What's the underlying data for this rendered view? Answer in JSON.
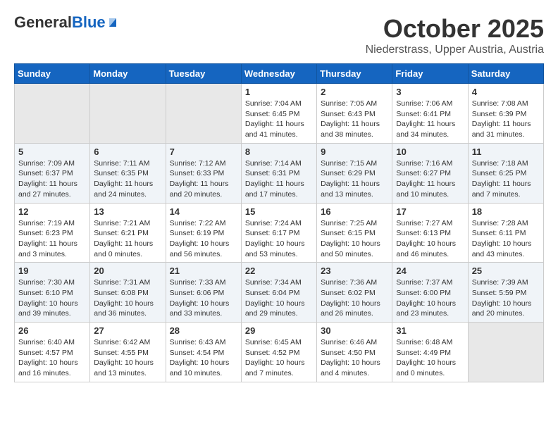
{
  "header": {
    "logo_general": "General",
    "logo_blue": "Blue",
    "month_title": "October 2025",
    "subtitle": "Niederstrass, Upper Austria, Austria"
  },
  "weekdays": [
    "Sunday",
    "Monday",
    "Tuesday",
    "Wednesday",
    "Thursday",
    "Friday",
    "Saturday"
  ],
  "weeks": [
    [
      {
        "day": "",
        "info": ""
      },
      {
        "day": "",
        "info": ""
      },
      {
        "day": "",
        "info": ""
      },
      {
        "day": "1",
        "info": "Sunrise: 7:04 AM\nSunset: 6:45 PM\nDaylight: 11 hours\nand 41 minutes."
      },
      {
        "day": "2",
        "info": "Sunrise: 7:05 AM\nSunset: 6:43 PM\nDaylight: 11 hours\nand 38 minutes."
      },
      {
        "day": "3",
        "info": "Sunrise: 7:06 AM\nSunset: 6:41 PM\nDaylight: 11 hours\nand 34 minutes."
      },
      {
        "day": "4",
        "info": "Sunrise: 7:08 AM\nSunset: 6:39 PM\nDaylight: 11 hours\nand 31 minutes."
      }
    ],
    [
      {
        "day": "5",
        "info": "Sunrise: 7:09 AM\nSunset: 6:37 PM\nDaylight: 11 hours\nand 27 minutes."
      },
      {
        "day": "6",
        "info": "Sunrise: 7:11 AM\nSunset: 6:35 PM\nDaylight: 11 hours\nand 24 minutes."
      },
      {
        "day": "7",
        "info": "Sunrise: 7:12 AM\nSunset: 6:33 PM\nDaylight: 11 hours\nand 20 minutes."
      },
      {
        "day": "8",
        "info": "Sunrise: 7:14 AM\nSunset: 6:31 PM\nDaylight: 11 hours\nand 17 minutes."
      },
      {
        "day": "9",
        "info": "Sunrise: 7:15 AM\nSunset: 6:29 PM\nDaylight: 11 hours\nand 13 minutes."
      },
      {
        "day": "10",
        "info": "Sunrise: 7:16 AM\nSunset: 6:27 PM\nDaylight: 11 hours\nand 10 minutes."
      },
      {
        "day": "11",
        "info": "Sunrise: 7:18 AM\nSunset: 6:25 PM\nDaylight: 11 hours\nand 7 minutes."
      }
    ],
    [
      {
        "day": "12",
        "info": "Sunrise: 7:19 AM\nSunset: 6:23 PM\nDaylight: 11 hours\nand 3 minutes."
      },
      {
        "day": "13",
        "info": "Sunrise: 7:21 AM\nSunset: 6:21 PM\nDaylight: 11 hours\nand 0 minutes."
      },
      {
        "day": "14",
        "info": "Sunrise: 7:22 AM\nSunset: 6:19 PM\nDaylight: 10 hours\nand 56 minutes."
      },
      {
        "day": "15",
        "info": "Sunrise: 7:24 AM\nSunset: 6:17 PM\nDaylight: 10 hours\nand 53 minutes."
      },
      {
        "day": "16",
        "info": "Sunrise: 7:25 AM\nSunset: 6:15 PM\nDaylight: 10 hours\nand 50 minutes."
      },
      {
        "day": "17",
        "info": "Sunrise: 7:27 AM\nSunset: 6:13 PM\nDaylight: 10 hours\nand 46 minutes."
      },
      {
        "day": "18",
        "info": "Sunrise: 7:28 AM\nSunset: 6:11 PM\nDaylight: 10 hours\nand 43 minutes."
      }
    ],
    [
      {
        "day": "19",
        "info": "Sunrise: 7:30 AM\nSunset: 6:10 PM\nDaylight: 10 hours\nand 39 minutes."
      },
      {
        "day": "20",
        "info": "Sunrise: 7:31 AM\nSunset: 6:08 PM\nDaylight: 10 hours\nand 36 minutes."
      },
      {
        "day": "21",
        "info": "Sunrise: 7:33 AM\nSunset: 6:06 PM\nDaylight: 10 hours\nand 33 minutes."
      },
      {
        "day": "22",
        "info": "Sunrise: 7:34 AM\nSunset: 6:04 PM\nDaylight: 10 hours\nand 29 minutes."
      },
      {
        "day": "23",
        "info": "Sunrise: 7:36 AM\nSunset: 6:02 PM\nDaylight: 10 hours\nand 26 minutes."
      },
      {
        "day": "24",
        "info": "Sunrise: 7:37 AM\nSunset: 6:00 PM\nDaylight: 10 hours\nand 23 minutes."
      },
      {
        "day": "25",
        "info": "Sunrise: 7:39 AM\nSunset: 5:59 PM\nDaylight: 10 hours\nand 20 minutes."
      }
    ],
    [
      {
        "day": "26",
        "info": "Sunrise: 6:40 AM\nSunset: 4:57 PM\nDaylight: 10 hours\nand 16 minutes."
      },
      {
        "day": "27",
        "info": "Sunrise: 6:42 AM\nSunset: 4:55 PM\nDaylight: 10 hours\nand 13 minutes."
      },
      {
        "day": "28",
        "info": "Sunrise: 6:43 AM\nSunset: 4:54 PM\nDaylight: 10 hours\nand 10 minutes."
      },
      {
        "day": "29",
        "info": "Sunrise: 6:45 AM\nSunset: 4:52 PM\nDaylight: 10 hours\nand 7 minutes."
      },
      {
        "day": "30",
        "info": "Sunrise: 6:46 AM\nSunset: 4:50 PM\nDaylight: 10 hours\nand 4 minutes."
      },
      {
        "day": "31",
        "info": "Sunrise: 6:48 AM\nSunset: 4:49 PM\nDaylight: 10 hours\nand 0 minutes."
      },
      {
        "day": "",
        "info": ""
      }
    ]
  ]
}
